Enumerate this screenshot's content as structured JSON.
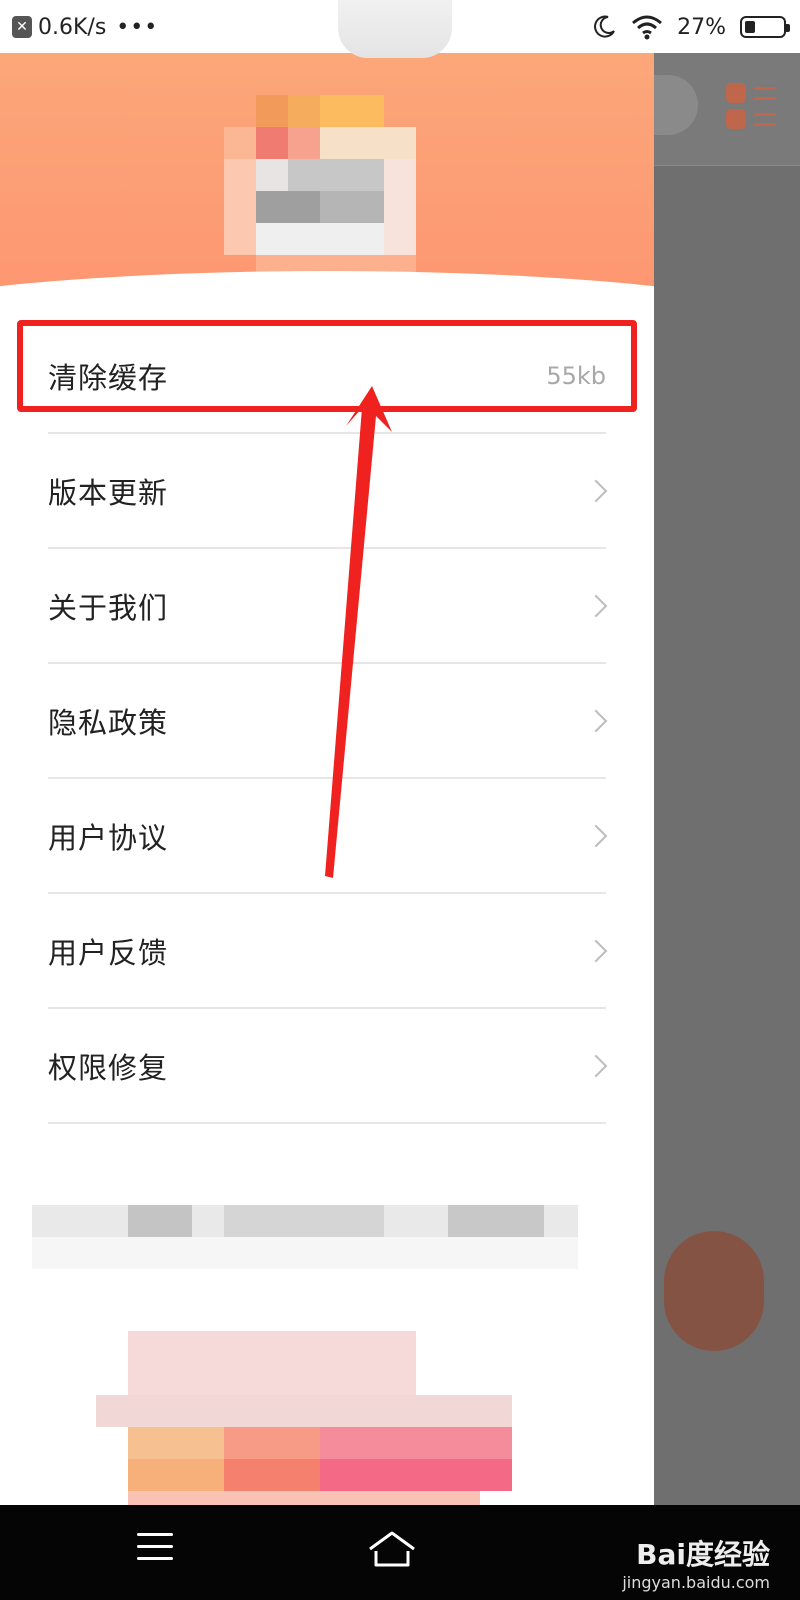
{
  "status_bar": {
    "net_speed": "0.6K/s",
    "more": "•••",
    "battery_text": "27%",
    "battery_level": 0.27,
    "icons": [
      "notification-icon",
      "moon-icon",
      "wifi-icon",
      "battery-icon"
    ]
  },
  "drawer": {
    "menu": [
      {
        "label": "清除缓存",
        "value": "55kb",
        "icon": "none"
      },
      {
        "label": "版本更新",
        "icon": "chevron-right-icon"
      },
      {
        "label": "关于我们",
        "icon": "chevron-right-icon"
      },
      {
        "label": "隐私政策",
        "icon": "chevron-right-icon"
      },
      {
        "label": "用户协议",
        "icon": "chevron-right-icon"
      },
      {
        "label": "用户反馈",
        "icon": "chevron-right-icon"
      },
      {
        "label": "权限修复",
        "icon": "chevron-right-icon"
      }
    ]
  },
  "background_app": {
    "menu_icon": "grid-list-icon"
  },
  "annotation": {
    "color": "#f0221f",
    "target": "清除缓存"
  },
  "nav_bar": {
    "icons": [
      "menu-icon",
      "home-icon"
    ]
  },
  "watermark": {
    "brand": "Bai度经验",
    "url": "jingyan.baidu.com"
  },
  "colors": {
    "header_top": "#fca77a",
    "header_bottom": "#fd9571",
    "dim_overlay": "#6f6f6f",
    "highlight": "#f0221f"
  }
}
